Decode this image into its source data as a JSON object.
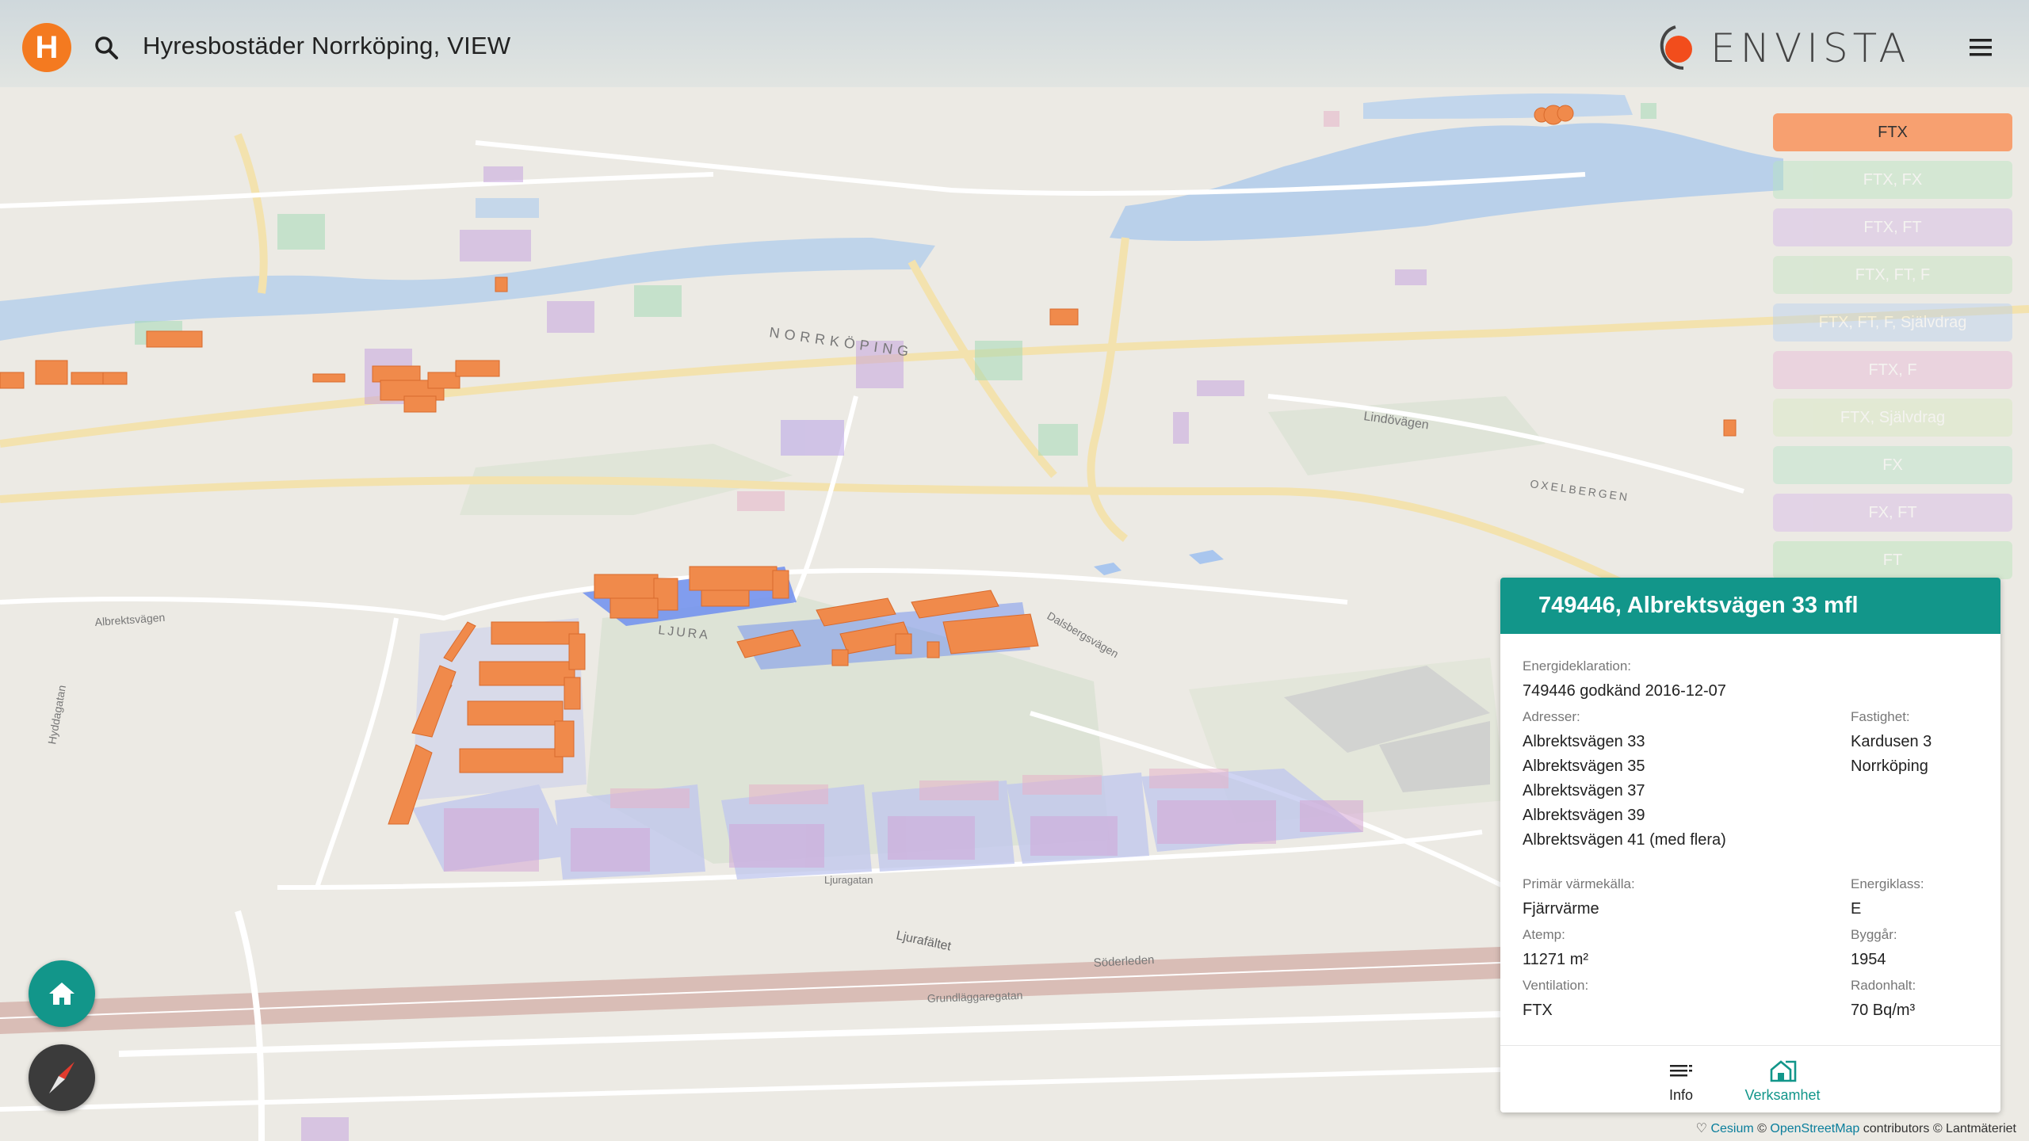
{
  "app": {
    "logo_letter": "H",
    "title": "Hyresbostäder Norrköping, VIEW",
    "brand": "ENVISTA"
  },
  "icons": {
    "search": "search-icon",
    "menu": "hamburger-menu-icon",
    "home": "home-icon",
    "compass": "compass-icon",
    "info_tab": "list-icon",
    "business_tab": "house-business-icon"
  },
  "colors": {
    "accent": "#12968a",
    "brand_orange": "#f47a20",
    "building_orange": "#f08a4b",
    "selected_footprint": "#6f8ff0"
  },
  "legend": {
    "items": [
      {
        "label": "FTX",
        "color": "#f7a070",
        "active": true
      },
      {
        "label": "FTX, FX",
        "color": "#b8e4c0",
        "active": false
      },
      {
        "label": "FTX, FT",
        "color": "#d4b8e8",
        "active": false
      },
      {
        "label": "FTX, FT, F",
        "color": "#c4e4c0",
        "active": false
      },
      {
        "label": "FTX, FT, F, Självdrag",
        "color": "#b8d0f0",
        "active": false
      },
      {
        "label": "FTX, F",
        "color": "#e8b8d8",
        "active": false
      },
      {
        "label": "FTX, Självdrag",
        "color": "#d8e8c0",
        "active": false
      },
      {
        "label": "FX",
        "color": "#b8e4c8",
        "active": false
      },
      {
        "label": "FX, FT",
        "color": "#d8b8e8",
        "active": false
      },
      {
        "label": "FT",
        "color": "#b8e4b8",
        "active": false
      }
    ]
  },
  "map_labels": {
    "norrkoping": "NORRKÖPING",
    "ljura": "LJURA",
    "ljurafaltet": "Ljurafältet",
    "ljuragatan": "Ljuragatan",
    "soderleden": "Söderleden",
    "grundlaggaregatan": "Grundläggaregatan",
    "lindovagen": "Lindövägen",
    "albrektsvagen": "Albrektsvägen",
    "dalsbergsvagen": "Dalsbergsvägen",
    "hyddagatan": "Hyddagatan",
    "oxelbergen": "OXELBERGEN"
  },
  "panel": {
    "title": "749446, Albrektsvägen 33 mfl",
    "energy_label": "Energideklaration:",
    "energy_value": "749446 godkänd 2016-12-07",
    "addresses_label": "Adresser:",
    "addresses": [
      "Albrektsvägen 33",
      "Albrektsvägen 35",
      "Albrektsvägen 37",
      "Albrektsvägen 39",
      "Albrektsvägen 41 (med flera)"
    ],
    "property_label": "Fastighet:",
    "property": [
      "Kardusen 3",
      "Norrköping"
    ],
    "heat_label": "Primär värmekälla:",
    "heat_value": "Fjärrvärme",
    "class_label": "Energiklass:",
    "class_value": "E",
    "atemp_label": "Atemp:",
    "atemp_value": "11271 m²",
    "year_label": "Byggår:",
    "year_value": "1954",
    "vent_label": "Ventilation:",
    "vent_value": "FTX",
    "radon_label": "Radonhalt:",
    "radon_value": "70 Bq/m³",
    "tabs": [
      {
        "label": "Info",
        "icon": "list-icon"
      },
      {
        "label": "Verksamhet",
        "icon": "house-business-icon"
      }
    ]
  },
  "credits": {
    "cesium": "Cesium",
    "copyright": "©",
    "osm": "OpenStreetMap",
    "rest": "contributors © Lantmäteriet"
  }
}
